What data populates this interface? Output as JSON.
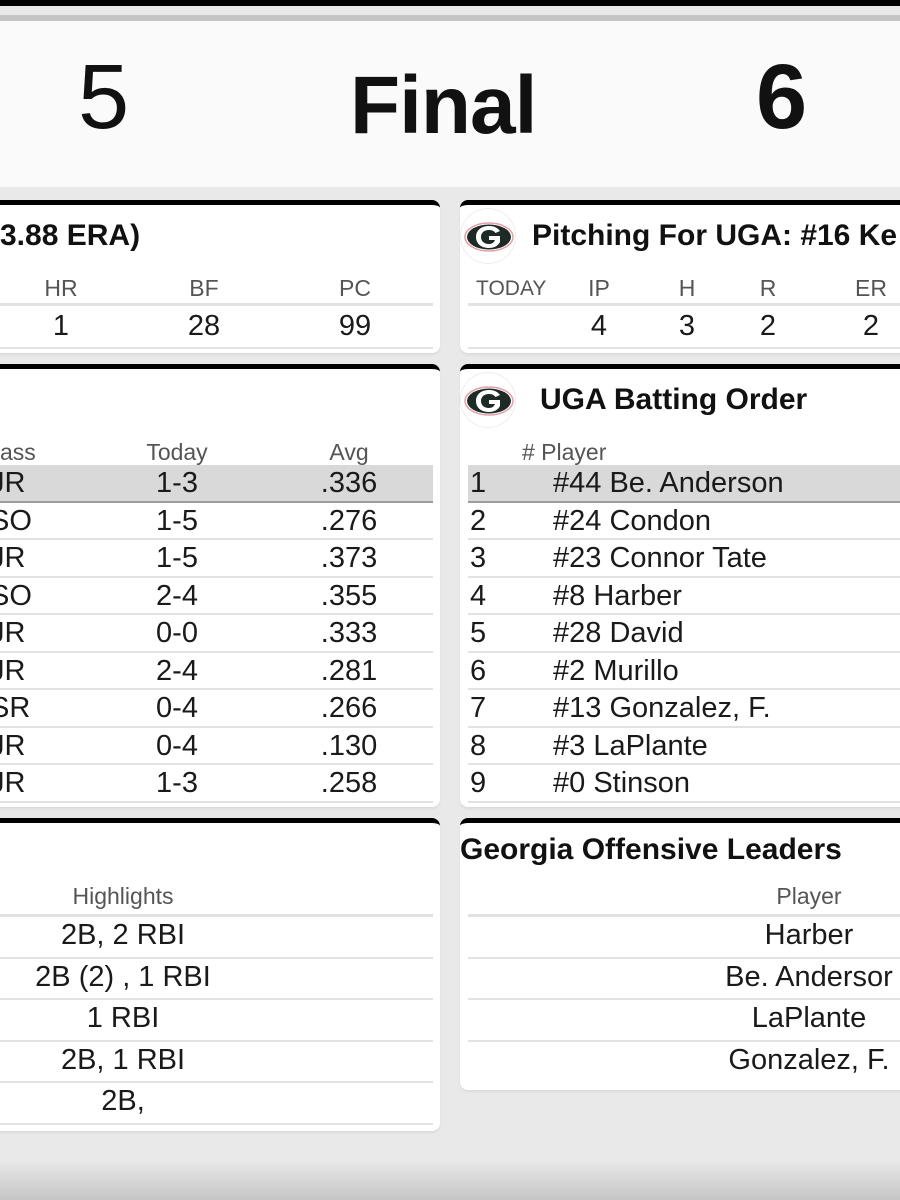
{
  "scoreboard": {
    "away_score": "5",
    "status": "Final",
    "home_score": "6"
  },
  "away_pitcher": {
    "title": "3.88 ERA)",
    "headers": [
      "HR",
      "BF",
      "PC"
    ],
    "values": [
      "1",
      "28",
      "99"
    ]
  },
  "home_pitcher": {
    "title": "Pitching For UGA: #16 Ke",
    "today_label": "TODAY",
    "headers": [
      "IP",
      "H",
      "R",
      "ER"
    ],
    "values": [
      "4",
      "3",
      "2",
      "2"
    ]
  },
  "away_lineup": {
    "headers": {
      "class": "ass",
      "today": "Today",
      "avg": "Avg"
    },
    "rows": [
      {
        "class": "JR",
        "today": "1-3",
        "avg": ".336"
      },
      {
        "class": "SO",
        "today": "1-5",
        "avg": ".276"
      },
      {
        "class": "JR",
        "today": "1-5",
        "avg": ".373"
      },
      {
        "class": "SO",
        "today": "2-4",
        "avg": ".355"
      },
      {
        "class": "JR",
        "today": "0-0",
        "avg": ".333"
      },
      {
        "class": "JR",
        "today": "2-4",
        "avg": ".281"
      },
      {
        "class": "SR",
        "today": "0-4",
        "avg": ".266"
      },
      {
        "class": "JR",
        "today": "0-4",
        "avg": ".130"
      },
      {
        "class": "JR",
        "today": "1-3",
        "avg": ".258"
      }
    ]
  },
  "home_lineup": {
    "title": "UGA Batting Order",
    "header": "# Player",
    "rows": [
      {
        "num": "1",
        "player": "#44 Be. Anderson"
      },
      {
        "num": "2",
        "player": "#24 Condon"
      },
      {
        "num": "3",
        "player": "#23 Connor Tate"
      },
      {
        "num": "4",
        "player": "#8 Harber"
      },
      {
        "num": "5",
        "player": "#28 David"
      },
      {
        "num": "6",
        "player": "#2 Murillo"
      },
      {
        "num": "7",
        "player": "#13 Gonzalez, F."
      },
      {
        "num": "8",
        "player": "#3 LaPlante"
      },
      {
        "num": "9",
        "player": "#0 Stinson"
      }
    ]
  },
  "away_leaders": {
    "header": "Highlights",
    "rows": [
      "2B, 2 RBI",
      "2B (2) , 1 RBI",
      "1 RBI",
      "2B, 1 RBI",
      "2B,"
    ]
  },
  "home_leaders": {
    "title": "Georgia Offensive Leaders",
    "header": "Player",
    "rows": [
      "Harber",
      "Be. Andersor",
      "LaPlante",
      "Gonzalez, F."
    ]
  },
  "colors": {
    "uga_red": "#ba0c2f",
    "uga_black": "#1d2a26",
    "highlight_row": "#d9d9d9"
  }
}
